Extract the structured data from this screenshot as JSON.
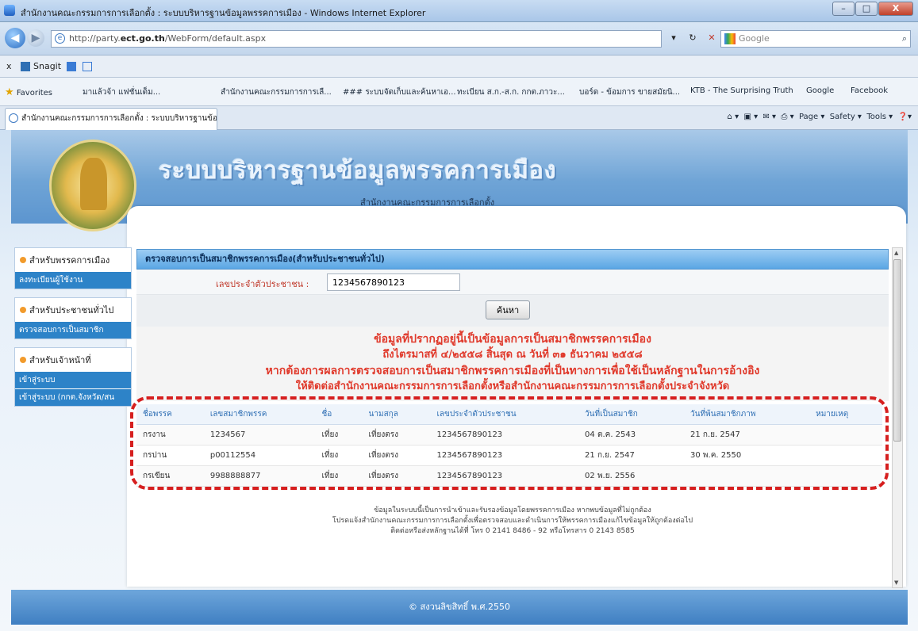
{
  "window": {
    "title": "สำนักงานคณะกรรมการการเลือกตั้ง : ระบบบริหารฐานข้อมูลพรรคการเมือง - Windows Internet Explorer",
    "minimize": "–",
    "maximize": "□",
    "close": "X"
  },
  "address": {
    "url_prefix": "http://party.",
    "url_host": "ect.go.th",
    "url_path": "/WebForm/default.aspx",
    "search_placeholder": "Google"
  },
  "toolbar": {
    "close_x": "x",
    "snagit": "Snagit"
  },
  "favorites": {
    "label": "Favorites",
    "items": [
      "มาแล้วจ้า แฟชั่นเด็ม...",
      "สำนักงานคณะกรรมการการเลื...",
      "### ระบบจัดเก็บและค้นหาเอ...",
      "ทะเบียน ส.ก.-ส.ก. กกต.ภาวะ...",
      "บอร์ด - ข้อมการ ขายสมัยนิ...",
      "KTB - The Surprising Truth",
      "Google",
      "Facebook"
    ]
  },
  "tab": {
    "label": "สำนักงานคณะกรรมการการเลือกตั้ง : ระบบบริหารฐานข้อ..."
  },
  "commands": {
    "page": "Page",
    "safety": "Safety",
    "tools": "Tools"
  },
  "header": {
    "title": "ระบบบริหารฐานข้อมูลพรรคการเมือง",
    "subtitle": "สำนักงานคณะกรรมการการเลือกตั้ง"
  },
  "sidebar": {
    "sections": [
      {
        "title": "สำหรับพรรคการเมือง",
        "links": [
          "ลงทะเบียนผู้ใช้งาน"
        ]
      },
      {
        "title": "สำหรับประชาชนทั่วไป",
        "links": [
          "ตรวจสอบการเป็นสมาชิก"
        ]
      },
      {
        "title": "สำหรับเจ้าหน้าที่",
        "links": [
          "เข้าสู่ระบบ",
          "เข้าสู่ระบบ (กกต.จังหวัด/สน"
        ]
      }
    ]
  },
  "main": {
    "section_title": "ตรวจสอบการเป็นสมาชิกพรรคการเมือง(สำหรับประชาชนทั่วไป)",
    "id_label": "เลขประจำตัวประชาชน :",
    "id_value": "1234567890123",
    "search_button": "ค้นหา",
    "notice": [
      "ข้อมูลที่ปรากฏอยู่นี้เป็นข้อมูลการเป็นสมาชิกพรรคการเมือง",
      "ถึงไตรมาสที่ ๔/๒๕๕๘ สิ้นสุด ณ วันที่ ๓๑ ธันวาคม ๒๕๕๘",
      "หากต้องการผลการตรวจสอบการเป็นสมาชิกพรรคการเมืองที่เป็นทางการเพื่อใช้เป็นหลักฐานในการอ้างอิง",
      "ให้ติดต่อสำนักงานคณะกรรมการการเลือกตั้งหรือสำนักงานคณะกรรมการการเลือกตั้งประจำจังหวัด"
    ]
  },
  "table": {
    "headers": [
      "ชื่อพรรค",
      "เลขสมาชิกพรรค",
      "ชื่อ",
      "นามสกุล",
      "เลขประจำตัวประชาชน",
      "วันที่เป็นสมาชิก",
      "วันที่พ้นสมาชิกภาพ",
      "หมายเหตุ"
    ],
    "rows": [
      [
        "กรงาน",
        "1234567",
        "เที่ยง",
        "เที่ยงตรง",
        "1234567890123",
        "04 ต.ค. 2543",
        "21 ก.ย. 2547",
        ""
      ],
      [
        "กรปาน",
        "p00112554",
        "เที่ยง",
        "เที่ยงตรง",
        "1234567890123",
        "21 ก.ย. 2547",
        "30 พ.ค. 2550",
        ""
      ],
      [
        "กรเขียน",
        "9988888877",
        "เที่ยง",
        "เที่ยงตรง",
        "1234567890123",
        "02 พ.ย. 2556",
        "",
        ""
      ]
    ]
  },
  "footer_note": [
    "ข้อมูลในระบบนี้เป็นการนำเข้าและรับรองข้อมูลโดยพรรคการเมือง หากพบข้อมูลที่ไม่ถูกต้อง",
    "โปรดแจ้งสำนักงานคณะกรรมการการเลือกตั้งเพื่อตรวจสอบและดำเนินการให้พรรคการเมืองแก้ไขข้อมูลให้ถูกต้องต่อไป",
    "ติดต่อหรือส่งหลักฐานได้ที่ โทร 0 2141 8486 - 92 หรือโทรสาร 0 2143 8585"
  ],
  "footer": "© สงวนลิขสิทธิ์ พ.ศ.2550",
  "colors": {
    "accent": "#2d83c8",
    "notice_red": "#e03a2c",
    "frame_red": "#d61f1f"
  }
}
